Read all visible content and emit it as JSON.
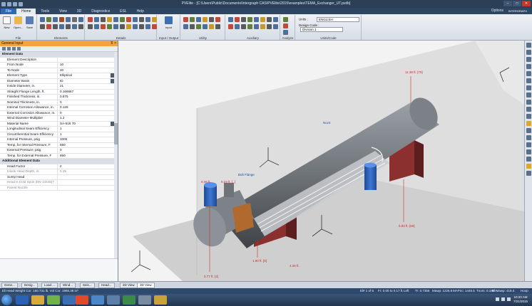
{
  "window": {
    "title": "PVElite - [C:\\Users\\Public\\Documents\\Intergraph CAS\\PVElite\\2015\\examples\\TEMA_Exchanger_UT.pvdb]",
    "controls": {
      "minimize": "–",
      "maximize": "□",
      "close": "✕"
    }
  },
  "ribbon": {
    "tabs": [
      "File",
      "Home",
      "Tools",
      "View",
      "3D",
      "Diagnostics",
      "ESL",
      "Help"
    ],
    "active_tab": "Home",
    "options_label": "Options",
    "logo_text": "INTERGRAPH",
    "groups": {
      "file": {
        "label": "File",
        "buttons": [
          "New",
          "Open...",
          "Save"
        ]
      },
      "elements": {
        "label": "Elements"
      },
      "details": {
        "label": "Details"
      },
      "input_output": {
        "label": "Input / Output",
        "button": "Input"
      },
      "utility": {
        "label": "Utility"
      },
      "auxiliary": {
        "label": "Auxiliary"
      },
      "analyze": {
        "label": "Analyze"
      },
      "units_code": {
        "label": "Units/Code",
        "units_label": "Units :",
        "units_value": "ENGLISH",
        "design_code_label": "Design Code :",
        "design_code_value": "Division 1"
      }
    }
  },
  "panel": {
    "title": "General Input",
    "pin": "⊼ ×",
    "sections": {
      "element_data": "Element Data",
      "additional_element_data": "Additional Element Data"
    },
    "rows": [
      {
        "k": "Element Description",
        "v": ""
      },
      {
        "k": "From Node",
        "v": "10"
      },
      {
        "k": "To Node",
        "v": "20"
      },
      {
        "k": "Element Type",
        "v": "Elliptical"
      },
      {
        "k": "Diameter Basis",
        "v": "ID"
      },
      {
        "k": "Inside Diameter, in.",
        "v": "21"
      },
      {
        "k": "Straight Flange Length, ft.",
        "v": "0.166667"
      },
      {
        "k": "Finished Thickness, in.",
        "v": "0.875"
      },
      {
        "k": "Nominal Thickness, in.",
        "v": "0"
      },
      {
        "k": "Internal Corrosion Allowance, in.",
        "v": "0.125"
      },
      {
        "k": "External Corrosion Allowance, in.",
        "v": "0"
      },
      {
        "k": "Wind Diameter Multiplier",
        "v": "1.2"
      },
      {
        "k": "Material Name",
        "v": "SA-516 70"
      },
      {
        "k": "Longitudinal Seam Efficiency",
        "v": "1"
      },
      {
        "k": "Circumferential Seam Efficiency",
        "v": "1"
      },
      {
        "k": "Internal Pressure, psig",
        "v": "1000"
      },
      {
        "k": "Temp. for Internal Pressure, F",
        "v": "650"
      },
      {
        "k": "External Pressure, psig",
        "v": "0"
      },
      {
        "k": "Temp. for External Pressure, F",
        "v": "650"
      }
    ],
    "additional_rows": [
      {
        "k": "Head Factor",
        "v": "2"
      },
      {
        "k": "Inside Head Depth, in.",
        "v": "5.25"
      },
      {
        "k": "Sump Head",
        "v": ""
      },
      {
        "k": "Head is Cold Spun (EN-13445)?",
        "v": ""
      },
      {
        "k": "Parent Nozzle",
        "v": ""
      }
    ]
  },
  "viewport": {
    "labels": {
      "top_right": "11.38 ft. [70]",
      "nozzle_mid": "Noz4",
      "nozzle_bolt": "Bolt Flange",
      "nozzle_left": "0.23 ft. [..]",
      "nozzle_blue": "0.36 ft.",
      "dim_bottom_left": "0.77 ft. [4]",
      "dim_bottom_mid": "1.90 ft. [5]",
      "dim_bottom_right": "5.83 ft. [60]",
      "dim_mid2": "4.25 ft."
    },
    "colors": {
      "shell": "#6e7378",
      "saddle": "#8b2f2f",
      "nozzle_blue": "#2a5fb8",
      "floor": "#cfcfcf",
      "wall": "#dedede"
    }
  },
  "bottom_tabs": [
    "Gene...",
    "Desig...",
    "Load ...",
    "Wind...",
    "Seis...",
    "Head...",
    "2D View",
    "3D View"
  ],
  "bottom_active": "3D View",
  "status": {
    "left": "Eli Head Weight Cor: 150.731 lb.  Vol Cor: 1965.38 in³",
    "element": "El# 1 of 6",
    "fr": "Fr: 0.00 to 0.17 ft.",
    "left_label": "Left",
    "tr": "Tr: 0.7356",
    "mawp": "Mawp: 1226.6",
    "mapnc": "MAPnc: 1446.5",
    "tnom": "Tnom: 0.188",
    "ehmawp": "EhMawp: 419.4",
    "hoop": "Hoop"
  },
  "taskbar": {
    "time": "10:20 AM",
    "date": "7/21/2015"
  }
}
